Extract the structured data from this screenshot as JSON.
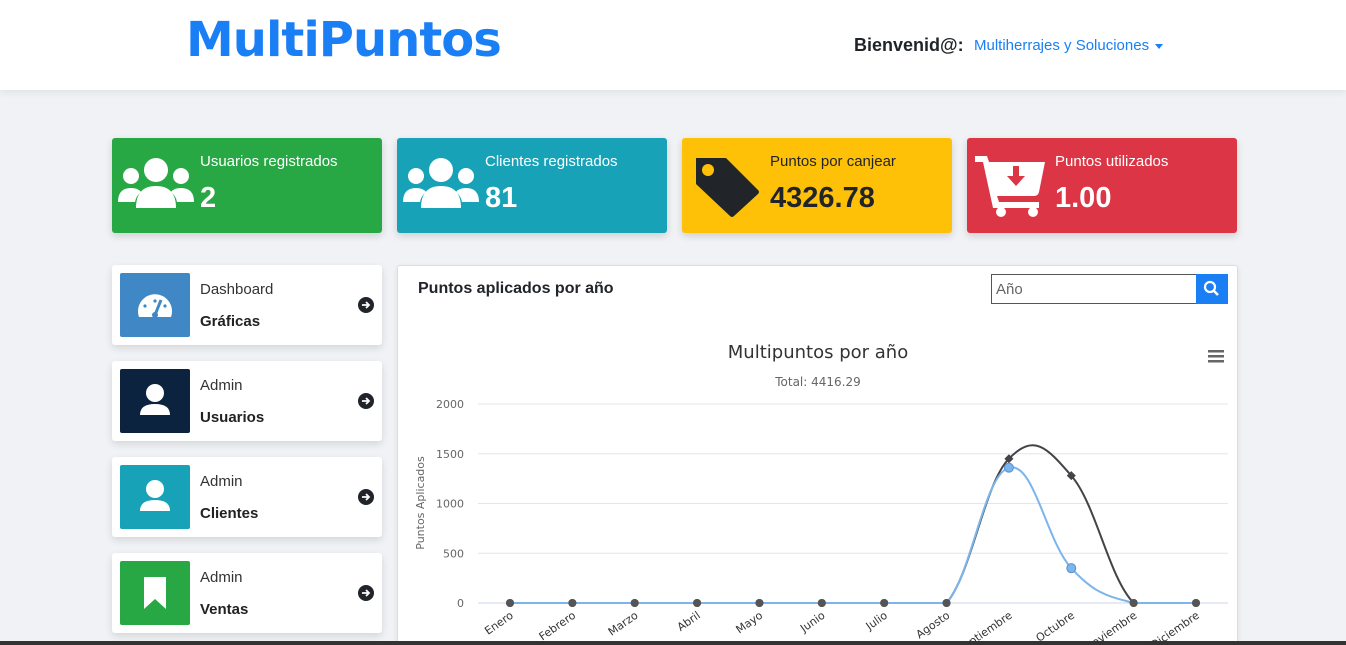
{
  "header": {
    "brand": "MultiPuntos",
    "welcome_label": "Bienvenid@:",
    "user_name": "Multiherrajes y Soluciones"
  },
  "stats": [
    {
      "label": "Usuarios registrados",
      "value": "2",
      "icon": "users-icon",
      "color": "#28a745"
    },
    {
      "label": "Clientes registrados",
      "value": "81",
      "icon": "users-icon",
      "color": "#17a2b8"
    },
    {
      "label": "Puntos por canjear",
      "value": "4326.78",
      "icon": "tag-icon",
      "color": "#ffc107"
    },
    {
      "label": "Puntos utilizados",
      "value": "1.00",
      "icon": "cart-download-icon",
      "color": "#dc3545"
    }
  ],
  "nav": [
    {
      "small": "Dashboard",
      "big": "Gráficas",
      "icon": "speedometer-icon",
      "color": "#3f88c5"
    },
    {
      "small": "Admin",
      "big": "Usuarios",
      "icon": "user-icon",
      "color": "#0c2340"
    },
    {
      "small": "Admin",
      "big": "Clientes",
      "icon": "user-icon",
      "color": "#17a2b8"
    },
    {
      "small": "Admin",
      "big": "Ventas",
      "icon": "bookmark-icon",
      "color": "#28a745"
    }
  ],
  "panel": {
    "title": "Puntos aplicados por año",
    "search_placeholder": "Año"
  },
  "chart_data": {
    "type": "line",
    "title": "Multipuntos por año",
    "subtitle": "Total: 4416.29",
    "ylabel": "Puntos Aplicados",
    "ylim": [
      0,
      2000
    ],
    "yticks": [
      0,
      500,
      1000,
      1500,
      2000
    ],
    "categories": [
      "Enero",
      "Febrero",
      "Marzo",
      "Abril",
      "Mayo",
      "Junio",
      "Julio",
      "Agosto",
      "Septiembre",
      "Octubre",
      "Noviembre",
      "Diciembre"
    ],
    "series": [
      {
        "values": [
          0,
          0,
          0,
          0,
          0,
          0,
          0,
          0,
          1360,
          350,
          0,
          0
        ],
        "color": "#7cb5ec",
        "marker": "circle"
      },
      {
        "values": [
          0,
          0,
          0,
          0,
          0,
          0,
          0,
          0,
          1450,
          1280,
          0,
          0
        ],
        "color": "#434348",
        "marker": "diamond"
      }
    ]
  }
}
